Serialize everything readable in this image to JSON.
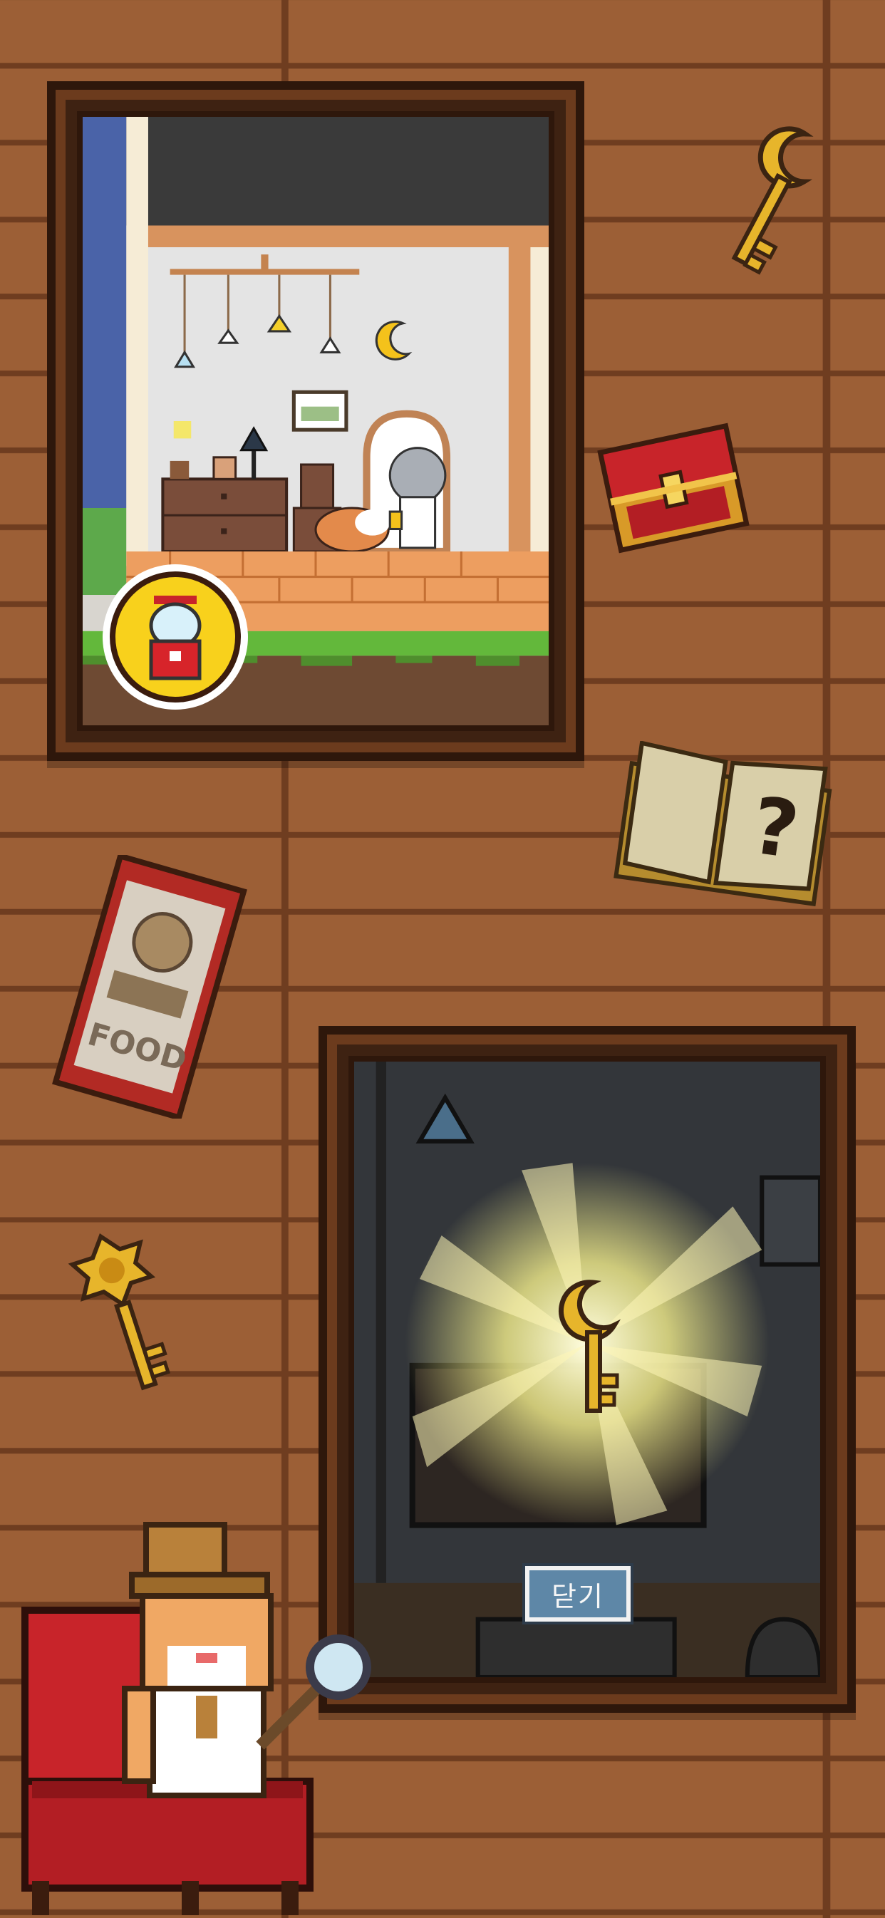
{
  "dialog": {
    "close_label": "닫기"
  },
  "icons": [
    "gold-key-icon",
    "treasure-chest-icon",
    "mystery-book-icon",
    "cat-food-can-icon",
    "ornate-key-icon",
    "gacha-machine-badge-icon",
    "moon-key-icon",
    "detective-cat-icon"
  ],
  "colors": {
    "wood_wall": "#9c5f36",
    "wood_line": "#6f3d20",
    "frame_dark": "#2e170b",
    "gold": "#e7b52b",
    "red": "#c8242a",
    "button_blue": "#5e87a7"
  }
}
